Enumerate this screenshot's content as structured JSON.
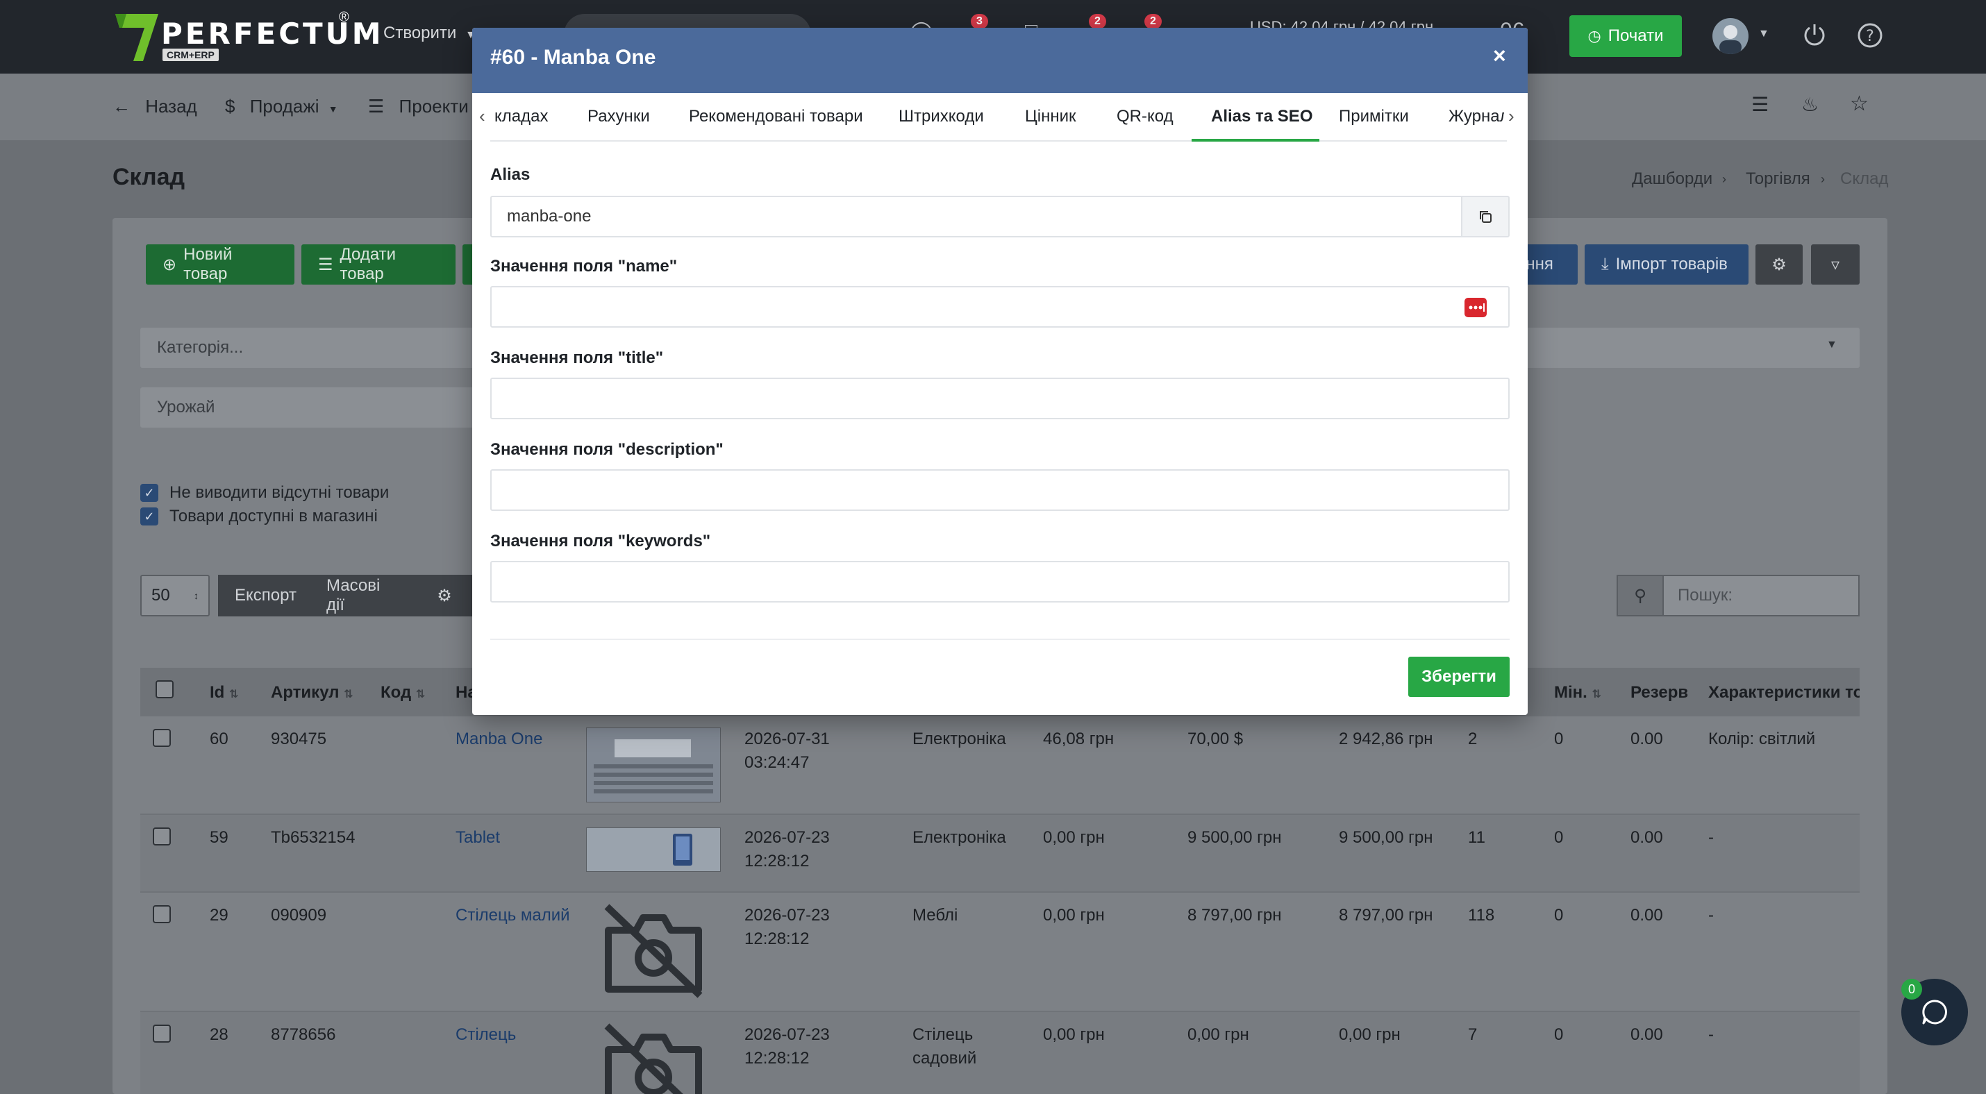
{
  "topbar": {
    "logo_text": "PERFECTUM",
    "logo_sub": "CRM+ERP",
    "logo_reg": "®",
    "create_label": "Створити",
    "badges": [
      "3",
      "2",
      "2"
    ],
    "currency": "USD: 42,04 грн / 42,04 грн",
    "clock": "06",
    "start_label": "Почати"
  },
  "subbar": {
    "back": "Назад",
    "sales": "Продажі",
    "projects": "Проекти"
  },
  "page": {
    "title": "Склад",
    "breadcrumbs": [
      "Дашборди",
      "Торгівля",
      "Склад"
    ]
  },
  "actions": {
    "new_product": "Новий товар",
    "add_product": "Додати товар",
    "partial_label": "ення",
    "import_products": "Імпорт товарів"
  },
  "filters": {
    "category_placeholder": "Категорія...",
    "harvest_placeholder": "Урожай",
    "hide_missing": "Не виводити відсутні товари",
    "available_in_store": "Товари доступні в магазині"
  },
  "table_toolbar": {
    "per_page": "50",
    "export": "Експорт",
    "bulk_actions": "Масові дії",
    "search_placeholder": "Пошук:"
  },
  "table": {
    "headers": {
      "id": "Id",
      "sku": "Артикул",
      "code": "Код",
      "name": "На",
      "min": "Мін.",
      "reserve": "Резерв",
      "characteristics": "Характеристики тов"
    },
    "rows": [
      {
        "id": "60",
        "sku": "930475",
        "name": "Manba One",
        "date": "2026-07-31",
        "time": "03:24:47",
        "category": "Електроніка",
        "cost": "46,08 грн",
        "price": "70,00 $",
        "total": "2 942,86 грн",
        "qty": "2",
        "min": "0",
        "reserve": "0.00",
        "chars": "Колір: світлий"
      },
      {
        "id": "59",
        "sku": "Tb6532154",
        "name": "Tablet",
        "date": "2026-07-23",
        "time": "12:28:12",
        "category": "Електроніка",
        "cost": "0,00 грн",
        "price": "9 500,00 грн",
        "total": "9 500,00 грн",
        "qty": "11",
        "min": "0",
        "reserve": "0.00",
        "chars": "-"
      },
      {
        "id": "29",
        "sku": "090909",
        "name": "Стілець малий",
        "date": "2026-07-23",
        "time": "12:28:12",
        "category": "Меблі",
        "cost": "0,00 грн",
        "price": "8 797,00 грн",
        "total": "8 797,00 грн",
        "qty": "118",
        "min": "0",
        "reserve": "0.00",
        "chars": "-"
      },
      {
        "id": "28",
        "sku": "8778656",
        "name": "Стілець",
        "date": "2026-07-23",
        "time": "12:28:12",
        "category": "Стілець",
        "category2": "садовий",
        "cost": "0,00 грн",
        "price": "0,00 грн",
        "total": "0,00 грн",
        "qty": "7",
        "min": "0",
        "reserve": "0.00",
        "chars": "-"
      }
    ]
  },
  "modal": {
    "title": "#60 - Manba One",
    "close": "×",
    "tabs": [
      "кладах",
      "Рахунки",
      "Рекомендовані товари",
      "Штрихкоди",
      "Цінник",
      "QR-код",
      "Alias та SEO",
      "Примітки",
      "Журнал"
    ],
    "active_tab": "Alias та SEO",
    "fields": {
      "alias_label": "Alias",
      "alias_value": "manba-one",
      "name_label": "Значення поля \"name\"",
      "title_label": "Значення поля \"title\"",
      "description_label": "Значення поля \"description\"",
      "keywords_label": "Значення поля \"keywords\""
    },
    "save": "Зберегти"
  },
  "chat": {
    "badge": "0"
  },
  "colors": {
    "accent_green": "#28a745",
    "modal_header": "#4b6a9b",
    "primary_blue": "#2a4a75"
  }
}
